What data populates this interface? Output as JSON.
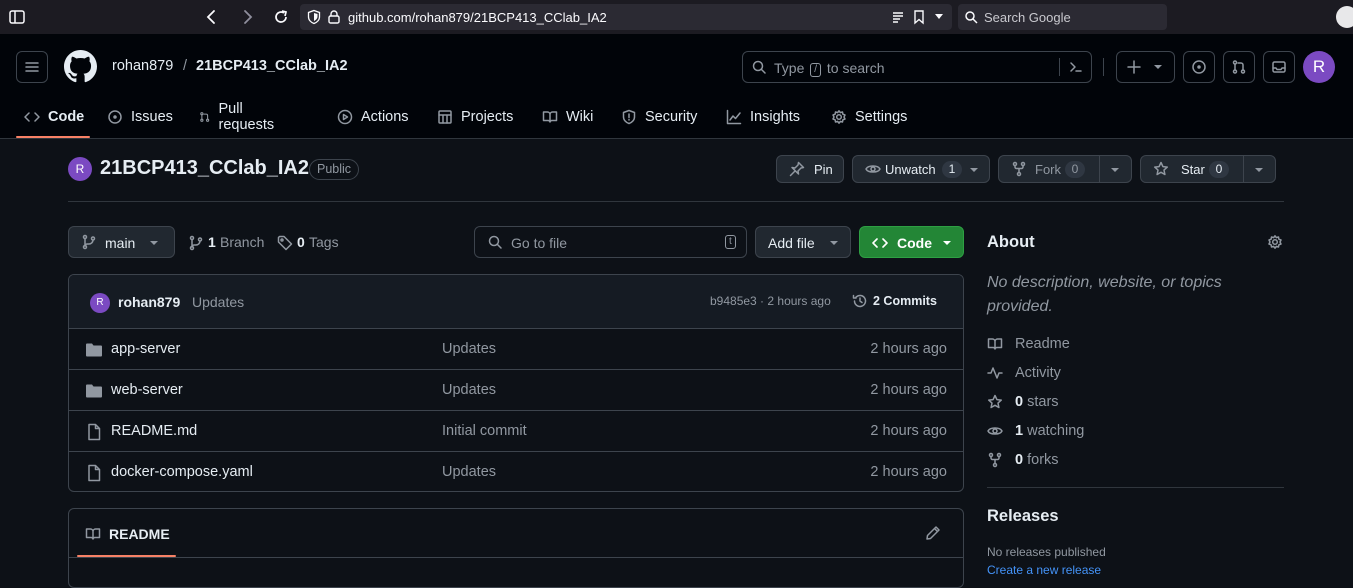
{
  "browser": {
    "url": "github.com/rohan879/21BCP413_CClab_IA2",
    "search_placeholder": "Search Google"
  },
  "header": {
    "owner": "rohan879",
    "separator": "/",
    "repo": "21BCP413_CClab_IA2",
    "search_prefix": "Type",
    "search_key": "/",
    "search_suffix": "to search",
    "avatar_letter": "R"
  },
  "tabs": [
    {
      "label": "Code",
      "icon": "code-icon",
      "active": true
    },
    {
      "label": "Issues",
      "icon": "issue-icon"
    },
    {
      "label": "Pull requests",
      "icon": "pull-request-icon"
    },
    {
      "label": "Actions",
      "icon": "play-icon"
    },
    {
      "label": "Projects",
      "icon": "table-icon"
    },
    {
      "label": "Wiki",
      "icon": "book-icon"
    },
    {
      "label": "Security",
      "icon": "shield-icon"
    },
    {
      "label": "Insights",
      "icon": "graph-icon"
    },
    {
      "label": "Settings",
      "icon": "gear-icon"
    }
  ],
  "repo": {
    "avatar_letter": "R",
    "title": "21BCP413_CClab_IA2",
    "visibility": "Public",
    "pin_label": "Pin",
    "unwatch_label": "Unwatch",
    "watch_count": "1",
    "fork_label": "Fork",
    "fork_count": "0",
    "star_label": "Star",
    "star_count": "0"
  },
  "branch_bar": {
    "branch": "main",
    "branch_count": "1",
    "branch_label": "Branch",
    "tag_count": "0",
    "tag_label": "Tags",
    "goto_placeholder": "Go to file",
    "goto_key": "t",
    "add_file_label": "Add file",
    "code_label": "Code"
  },
  "latest_commit": {
    "avatar_letter": "R",
    "author": "rohan879",
    "message": "Updates",
    "hash_time": "b9485e3 · 2 hours ago",
    "commits_label": "2 Commits"
  },
  "files": [
    {
      "name": "app-server",
      "type": "folder",
      "message": "Updates",
      "time": "2 hours ago"
    },
    {
      "name": "web-server",
      "type": "folder",
      "message": "Updates",
      "time": "2 hours ago"
    },
    {
      "name": "README.md",
      "type": "file",
      "message": "Initial commit",
      "time": "2 hours ago"
    },
    {
      "name": "docker-compose.yaml",
      "type": "file",
      "message": "Updates",
      "time": "2 hours ago"
    }
  ],
  "readme": {
    "label": "README"
  },
  "about": {
    "title": "About",
    "description": "No description, website, or topics provided.",
    "readme_label": "Readme",
    "activity_label": "Activity",
    "stars_count": "0",
    "stars_label": "stars",
    "watching_count": "1",
    "watching_label": "watching",
    "forks_count": "0",
    "forks_label": "forks"
  },
  "releases": {
    "title": "Releases",
    "none_text": "No releases published",
    "create_link": "Create a new release"
  },
  "colors": {
    "accent_underline": "#f78166",
    "code_button": "#238636",
    "avatar": "#7b4ac2",
    "link": "#4493f8"
  }
}
